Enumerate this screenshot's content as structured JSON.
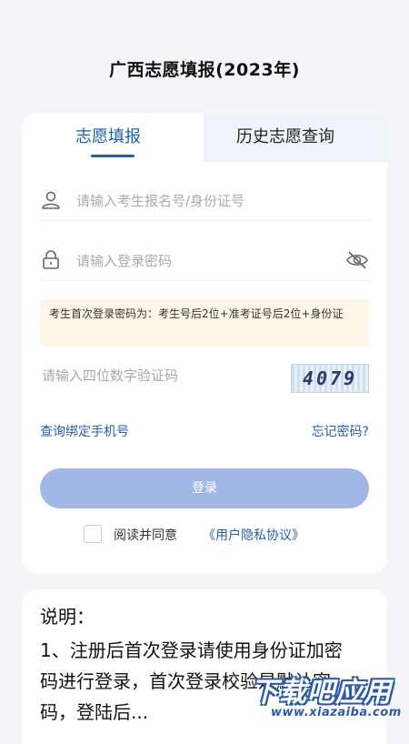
{
  "header": {
    "title": "广西志愿填报(2023年)"
  },
  "tabs": [
    {
      "label": "志愿填报",
      "active": true
    },
    {
      "label": "历史志愿查询",
      "active": false
    }
  ],
  "form": {
    "account_placeholder": "请输入考生报名号/身份证号",
    "password_placeholder": "请输入登录密码",
    "notice": "考生首次登录密码为：考生号后2位+准考证号后2位+身份证",
    "captcha_placeholder": "请输入四位数字验证码",
    "captcha_code": "4079",
    "bind_phone_link": "查询绑定手机号",
    "forgot_password_link": "忘记密码?",
    "login_button": "登录",
    "agree_text": "阅读并同意",
    "agree_link": "《用户隐私协议》"
  },
  "description": {
    "title": "说明：",
    "body": "1、注册后首次登录请使用身份证加密码进行登录，首次登录校验是默认密码，登陆后..."
  },
  "watermark": {
    "main": "下载吧应用",
    "sub": "www.xiazaiba.com"
  },
  "colors": {
    "accent": "#2c5ca3",
    "login_button": "#a1b7e6",
    "notice_bg": "#fdf6e9",
    "page_bg": "#f4f5f8"
  },
  "icons": {
    "account": "user-icon",
    "password": "lock-icon",
    "toggle_password": "eye-off-icon"
  }
}
